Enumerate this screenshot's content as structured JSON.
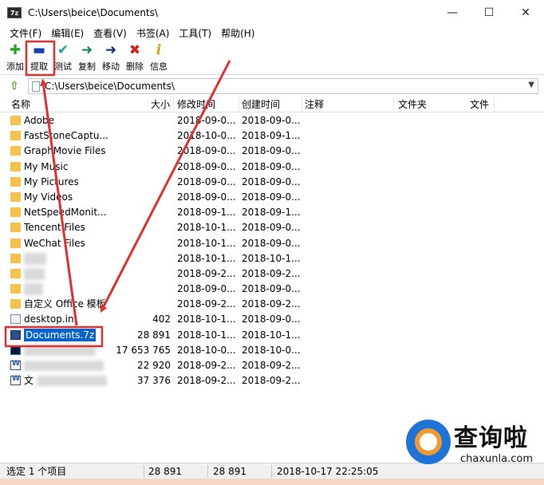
{
  "window": {
    "app_icon_text": "7z",
    "title": "C:\\Users\\beice\\Documents\\",
    "controls": {
      "minimize": "—",
      "maximize": "☐",
      "close": "✕"
    }
  },
  "menu": [
    "文件(F)",
    "编辑(E)",
    "查看(V)",
    "书签(A)",
    "工具(T)",
    "帮助(H)"
  ],
  "toolbar": [
    {
      "label": "添加",
      "icon": "plus-icon",
      "glyph": "✚",
      "color": "#2aa52a"
    },
    {
      "label": "提取",
      "icon": "minus-icon",
      "glyph": "▬",
      "color": "#1a3fa8"
    },
    {
      "label": "测试",
      "icon": "check-icon",
      "glyph": "✔",
      "color": "#1aa0a0"
    },
    {
      "label": "复制",
      "icon": "arrow-right-icon",
      "glyph": "➜",
      "color": "#14865c"
    },
    {
      "label": "移动",
      "icon": "arrow-right-icon",
      "glyph": "➜",
      "color": "#14306e"
    },
    {
      "label": "删除",
      "icon": "delete-x-icon",
      "glyph": "✖",
      "color": "#d81e1e"
    },
    {
      "label": "信息",
      "icon": "info-icon",
      "glyph": "i",
      "color": "#d4a00a"
    }
  ],
  "address": {
    "path": "C:\\Users\\beice\\Documents\\"
  },
  "columns": [
    "名称",
    "大小",
    "修改时间",
    "创建时间",
    "注释",
    "文件夹",
    "文件"
  ],
  "rows": [
    {
      "name": "Adobe",
      "size": "",
      "modified": "2018-09-0...",
      "created": "2018-09-0...",
      "type": "folder"
    },
    {
      "name": "FastStoneCaptu...",
      "size": "",
      "modified": "2018-10-0...",
      "created": "2018-09-1...",
      "type": "folder"
    },
    {
      "name": "GraphMovie Files",
      "size": "",
      "modified": "2018-09-0...",
      "created": "2018-09-0...",
      "type": "folder"
    },
    {
      "name": "My Music",
      "size": "",
      "modified": "2018-09-0...",
      "created": "2018-09-0...",
      "type": "folder"
    },
    {
      "name": "My Pictures",
      "size": "",
      "modified": "2018-09-0...",
      "created": "2018-09-0...",
      "type": "folder"
    },
    {
      "name": "My Videos",
      "size": "",
      "modified": "2018-09-0...",
      "created": "2018-09-0...",
      "type": "folder"
    },
    {
      "name": "NetSpeedMonit...",
      "size": "",
      "modified": "2018-09-1...",
      "created": "2018-09-1...",
      "type": "folder"
    },
    {
      "name": "Tencent Files",
      "size": "",
      "modified": "2018-10-1...",
      "created": "2018-09-0...",
      "type": "folder"
    },
    {
      "name": "WeChat Files",
      "size": "",
      "modified": "2018-10-1...",
      "created": "2018-09-0...",
      "type": "folder"
    },
    {
      "name": "",
      "size": "",
      "modified": "2018-10-1...",
      "created": "2018-10-1...",
      "type": "folder",
      "blurred": true
    },
    {
      "name": "",
      "size": "",
      "modified": "2018-09-2...",
      "created": "2018-09-2...",
      "type": "folder",
      "blurred": true
    },
    {
      "name": "",
      "size": "",
      "modified": "2018-09-0...",
      "created": "2018-09-0...",
      "type": "folder",
      "blurred": true
    },
    {
      "name": "自定义 Office 模板",
      "size": "",
      "modified": "2018-09-2...",
      "created": "2018-09-2...",
      "type": "folder"
    },
    {
      "name": "desktop.ini",
      "size": "402",
      "modified": "2018-10-1...",
      "created": "2018-09-0...",
      "type": "ini"
    },
    {
      "name": "Documents.7z",
      "size": "28 891",
      "modified": "2018-10-1...",
      "created": "2018-10-1...",
      "type": "archive",
      "selected": true
    },
    {
      "name": "",
      "size": "17 653 765",
      "modified": "2018-10-0...",
      "created": "2018-10-0...",
      "type": "ps",
      "blurred": true
    },
    {
      "name": "",
      "size": "22 920",
      "modified": "2018-09-2...",
      "created": "2018-09-2...",
      "type": "word",
      "blurred": true
    },
    {
      "name": "文",
      "size": "37 376",
      "modified": "2018-09-2...",
      "created": "2018-09-2...",
      "type": "word",
      "blurred": true
    }
  ],
  "status": {
    "selection": "选定 1 个项目",
    "size": "28 891",
    "packed": "28 891",
    "modified": "2018-10-17 22:25:05"
  },
  "watermark": {
    "text_cn": "查询啦",
    "text_en": "chaxunla.com"
  },
  "annotation_color": "#e03030"
}
